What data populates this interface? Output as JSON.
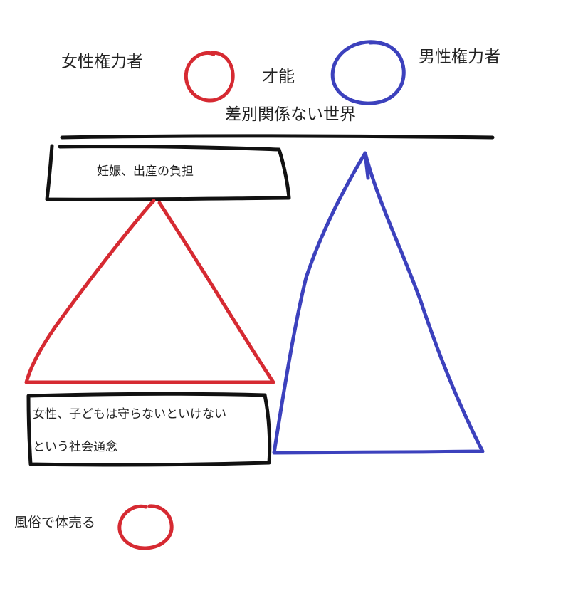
{
  "labels": {
    "female_power": "女性権力者",
    "talent": "才能",
    "male_power": "男性権力者",
    "no_discrimination": "差別関係ない世界",
    "pregnancy_burden": "妊娠、出産の負担",
    "social_norm_line1": "女性、子どもは守らないといけない",
    "social_norm_line2": "という社会通念",
    "sex_work": "風俗で体売る"
  },
  "colors": {
    "female": "#d62a32",
    "male": "#3c41bd",
    "ink": "#111111",
    "background": "#ffffff"
  }
}
